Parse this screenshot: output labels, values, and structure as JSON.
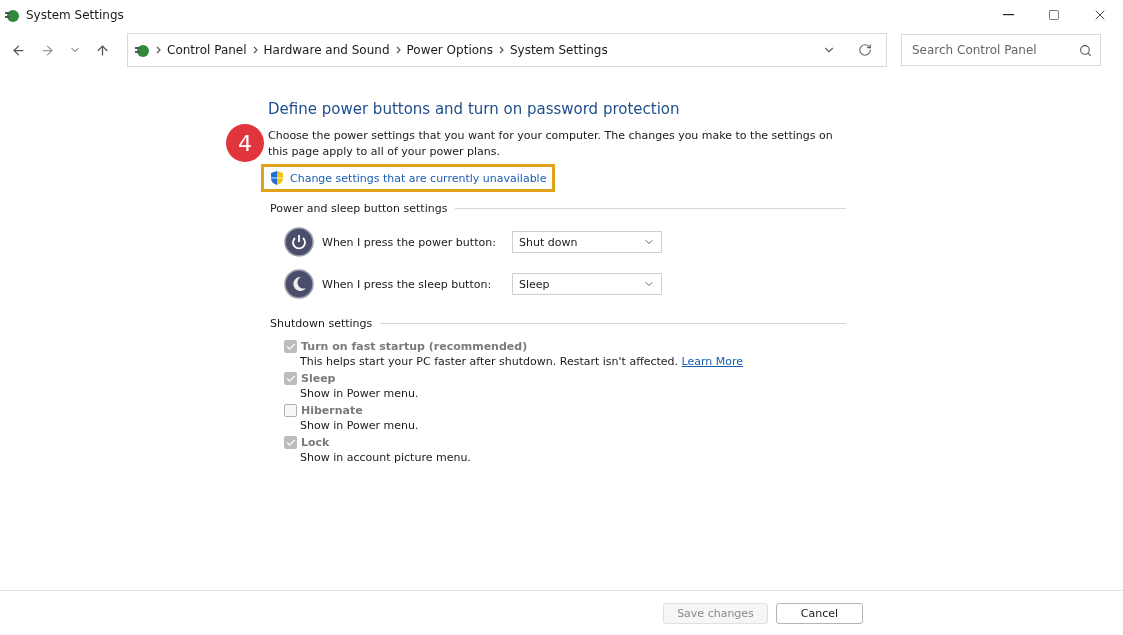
{
  "window": {
    "title": "System Settings"
  },
  "breadcrumb": [
    "Control Panel",
    "Hardware and Sound",
    "Power Options",
    "System Settings"
  ],
  "search": {
    "placeholder": "Search Control Panel"
  },
  "heading": "Define power buttons and turn on password protection",
  "step_badge": "4",
  "description": "Choose the power settings that you want for your computer. The changes you make to the settings on this page apply to all of your power plans.",
  "elevate_link": {
    "label": "Change settings that are currently unavailable",
    "highlighted": true
  },
  "button_section": {
    "title": "Power and sleep button settings",
    "rows": [
      {
        "kind": "power",
        "label": "When I press the power button:",
        "value": "Shut down"
      },
      {
        "kind": "sleep",
        "label": "When I press the sleep button:",
        "value": "Sleep"
      }
    ]
  },
  "shutdown_section": {
    "title": "Shutdown settings",
    "options": [
      {
        "label": "Turn on fast startup (recommended)",
        "checked": true,
        "disabled": true,
        "description": "This helps start your PC faster after shutdown. Restart isn't affected.",
        "link": "Learn More"
      },
      {
        "label": "Sleep",
        "checked": true,
        "disabled": true,
        "description": "Show in Power menu."
      },
      {
        "label": "Hibernate",
        "checked": false,
        "disabled": true,
        "description": "Show in Power menu."
      },
      {
        "label": "Lock",
        "checked": true,
        "disabled": true,
        "description": "Show in account picture menu."
      }
    ]
  },
  "buttons": [
    {
      "label": "Save changes",
      "disabled": true
    },
    {
      "label": "Cancel",
      "disabled": false
    }
  ]
}
